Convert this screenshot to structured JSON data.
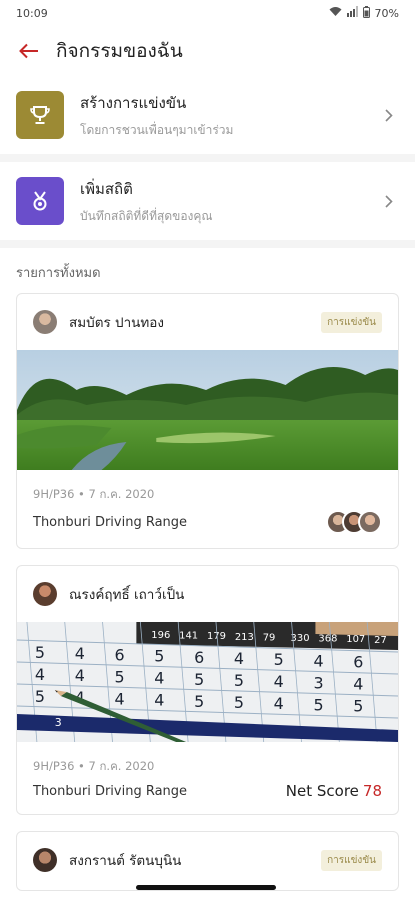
{
  "status": {
    "time": "10:09",
    "battery": "70%"
  },
  "header": {
    "title": "กิจกรรมของฉัน"
  },
  "actions": [
    {
      "title": "สร้างการแข่งขัน",
      "subtitle": "โดยการชวนเพื่อนๆมาเข้าร่วม",
      "icon": "trophy-icon",
      "color": "#9c8a34"
    },
    {
      "title": "เพิ่มสถิติ",
      "subtitle": "บันทึกสถิติที่ดีที่สุดของคุณ",
      "icon": "medal-icon",
      "color": "#6a4ecb"
    }
  ],
  "list": {
    "title": "รายการทั้งหมด"
  },
  "cards": [
    {
      "name": "สมบัตร ปานทอง",
      "badge": "การแข่งขัน",
      "meta": "9H/P36 • 7 ก.ค. 2020",
      "venue": "Thonburi Driving Range"
    },
    {
      "name": "ณรงค์ฤทธิ์ เถาว์เป็น",
      "meta": "9H/P36 • 7 ก.ค. 2020",
      "venue": "Thonburi Driving Range",
      "score_label": "Net Score",
      "score_value": "78"
    },
    {
      "name": "สงกรานต์ รัตนบุนิน",
      "badge": "การแข่งขัน"
    }
  ],
  "scorecard": {
    "header_numbers": [
      "196",
      "141",
      "179",
      "213",
      "79",
      "330",
      "368",
      "107",
      "27"
    ],
    "rows": [
      [
        "5",
        "4",
        "6",
        "5",
        "6",
        "4",
        "5",
        "4",
        "6"
      ],
      [
        "4",
        "4",
        "5",
        "4",
        "5",
        "5",
        "4",
        "3",
        "4"
      ],
      [
        "5",
        "4",
        "4",
        "4",
        "5",
        "5",
        "4",
        "5",
        "5"
      ]
    ],
    "row_label": "3"
  }
}
